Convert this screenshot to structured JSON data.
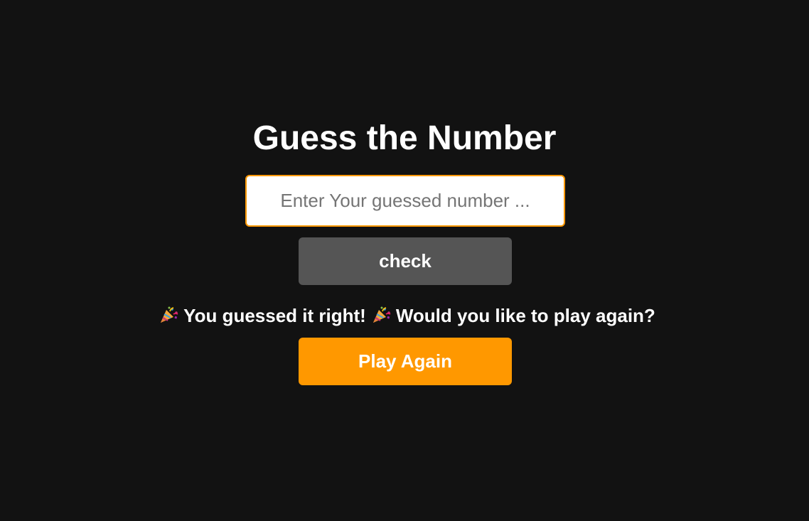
{
  "game": {
    "title": "Guess the Number",
    "input": {
      "placeholder": "Enter Your guessed number ...",
      "value": ""
    },
    "check_label": "check",
    "message": {
      "part1": "You guessed it right!",
      "part2": "Would you like to play again?",
      "icon": "party-popper-icon"
    },
    "play_again_label": "Play Again"
  },
  "colors": {
    "background": "#121212",
    "accent": "#ff9800",
    "check_button": "#555555",
    "text": "#ffffff"
  }
}
